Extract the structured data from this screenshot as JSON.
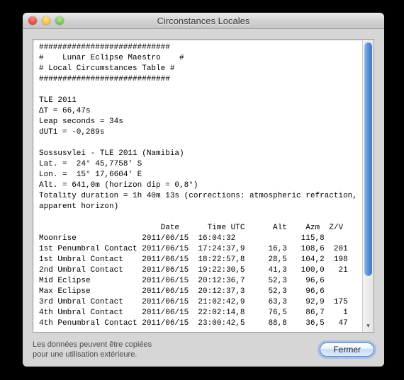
{
  "window": {
    "title": "Circonstances Locales"
  },
  "report": {
    "header_rule": "############################",
    "header_line1": "#    Lunar Eclipse Maestro    #",
    "header_line2": "# Local Circumstances Table #",
    "tle": "TLE 2011",
    "delta_t": "ΔT = 66,47s",
    "leap": "Leap seconds = 34s",
    "dut1": "dUT1 = -0,289s",
    "location": "Sossusvlei - TLE 2011 (Namibia)",
    "lat": "Lat. =  24° 45,7758' S",
    "lon": "Lon. =  15° 17,6604' E",
    "alt": "Alt. = 641,0m (horizon dip = 0,8°)",
    "totality": "Totality duration = 1h 40m 13s (corrections: atmospheric refraction,",
    "totality2": "apparent horizon)",
    "table_header": "                          Date      Time UTC      Alt    Azm  Z/V",
    "events": [
      {
        "name": "Moonrise",
        "date": "2011/06/15",
        "time": "16:04:32",
        "alt": "",
        "azm": "115,8",
        "zv": ""
      },
      {
        "name": "1st Penumbral Contact",
        "date": "2011/06/15",
        "time": "17:24:37,9",
        "alt": "16,3",
        "azm": "108,6",
        "zv": "201"
      },
      {
        "name": "1st Umbral Contact",
        "date": "2011/06/15",
        "time": "18:22:57,8",
        "alt": "28,5",
        "azm": "104,2",
        "zv": "198"
      },
      {
        "name": "2nd Umbral Contact",
        "date": "2011/06/15",
        "time": "19:22:30,5",
        "alt": "41,3",
        "azm": "100,0",
        "zv": "21"
      },
      {
        "name": "Mid Eclipse",
        "date": "2011/06/15",
        "time": "20:12:36,7",
        "alt": "52,3",
        "azm": "96,6",
        "zv": ""
      },
      {
        "name": "Max Eclipse",
        "date": "2011/06/15",
        "time": "20:12:37,3",
        "alt": "52,3",
        "azm": "96,6",
        "zv": ""
      },
      {
        "name": "3rd Umbral Contact",
        "date": "2011/06/15",
        "time": "21:02:42,9",
        "alt": "63,3",
        "azm": "92,9",
        "zv": "175"
      },
      {
        "name": "4th Umbral Contact",
        "date": "2011/06/15",
        "time": "22:02:14,8",
        "alt": "76,5",
        "azm": "86,7",
        "zv": "1"
      },
      {
        "name": "4th Penumbral Contact",
        "date": "2011/06/15",
        "time": "23:00:42,5",
        "alt": "88,8",
        "azm": "36,5",
        "zv": "47"
      }
    ]
  },
  "footer": {
    "hint": "Les données peuvent être copiées\npour une utilisation extérieure.",
    "close_label": "Fermer"
  }
}
